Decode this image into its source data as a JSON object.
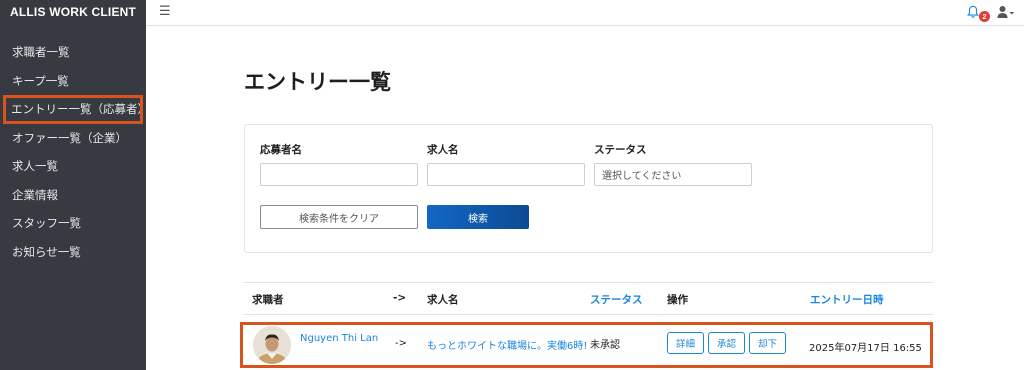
{
  "sidebar": {
    "brand": "ALLIS WORK CLIENT",
    "items": [
      {
        "label": "求職者一覧"
      },
      {
        "label": "キープ一覧"
      },
      {
        "label": "エントリー一覧（応募者）"
      },
      {
        "label": "オファー一覧（企業）"
      },
      {
        "label": "求人一覧"
      },
      {
        "label": "企業情報"
      },
      {
        "label": "スタッフ一覧"
      },
      {
        "label": "お知らせ一覧"
      }
    ],
    "active_index": 2
  },
  "topbar": {
    "menu_icon": "hamburger-icon",
    "bell_icon": "bell-icon",
    "notification_count": "2",
    "user_icon": "user-icon"
  },
  "page": {
    "title": "エントリー一覧"
  },
  "filters": {
    "applicant_label": "応募者名",
    "applicant_value": "",
    "job_label": "求人名",
    "job_value": "",
    "status_label": "ステータス",
    "status_selected": "選択してください",
    "clear_label": "検索条件をクリア",
    "search_label": "検索"
  },
  "table": {
    "headers": {
      "applicant": "求職者",
      "arrow": "->",
      "job": "求人名",
      "status": "ステータス",
      "actions": "操作",
      "entry_date": "エントリー日時"
    },
    "rows": [
      {
        "name": "Nguyen Thi Lan",
        "arrow": "->",
        "job": "もっとホワイトな職場に。実働6時!",
        "status": "未承認",
        "detail": "詳細",
        "approve": "承認",
        "reject": "却下",
        "entry_date": "2025年07月17日 16:55"
      }
    ]
  },
  "colors": {
    "sidebar_bg": "#373a40",
    "accent": "#1a86e0",
    "highlight": "#d9531e",
    "badge": "#e53935"
  }
}
